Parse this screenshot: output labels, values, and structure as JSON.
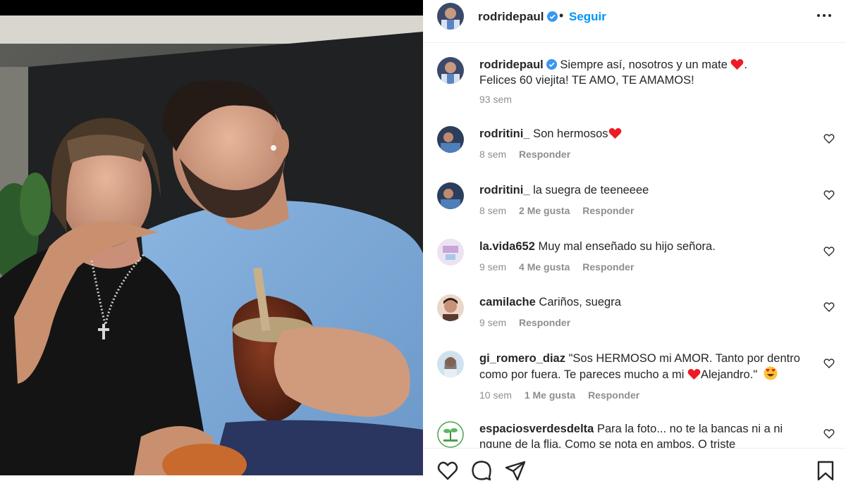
{
  "post": {
    "author": "rodridepaul",
    "follow_label": "Seguir",
    "dot": "•"
  },
  "caption": {
    "user": "rodridepaul",
    "line1": "Siempre así, nosotros y un mate",
    "line1_end": ".",
    "line2": "Felices 60 viejita! TE AMO, TE AMAMOS!",
    "time": "93 sem"
  },
  "comments": [
    {
      "user": "rodritini_",
      "text": "Son hermosos",
      "time": "8 sem",
      "likes": "",
      "reply": "Responder"
    },
    {
      "user": "rodritini_",
      "text": "la suegra de teeneeee",
      "time": "8 sem",
      "likes": "2 Me gusta",
      "reply": "Responder"
    },
    {
      "user": "la.vida652",
      "text": "Muy mal enseñado su hijo señora.",
      "time": "9 sem",
      "likes": "4 Me gusta",
      "reply": "Responder"
    },
    {
      "user": "camilache",
      "text": "Cariños, suegra",
      "time": "9 sem",
      "likes": "",
      "reply": "Responder"
    },
    {
      "user": "gi_romero_diaz",
      "text_line1": "\"Sos HERMOSO mi AMOR. Tanto por dentro",
      "text_line2a": "como por fuera. Te pareces mucho a mi",
      "text_line2b": "Alejandro.\"",
      "time": "10 sem",
      "likes": "1 Me gusta",
      "reply": "Responder"
    },
    {
      "user": "espaciosverdesdelta",
      "text_line1": "Para la foto... no te la bancas ni a ni",
      "text_line2": "ngune de la flia. Como se nota en ambos. Q triste"
    }
  ],
  "icons": {
    "verified": "verified-badge-icon",
    "more": "more-options-icon",
    "like": "heart-outline-icon",
    "comment": "comment-bubble-icon",
    "share": "paper-plane-icon",
    "save": "bookmark-icon"
  },
  "colors": {
    "accent": "#0095f6",
    "heart": "#ed1c24",
    "muted": "#8e8e8e",
    "text": "#262626"
  }
}
